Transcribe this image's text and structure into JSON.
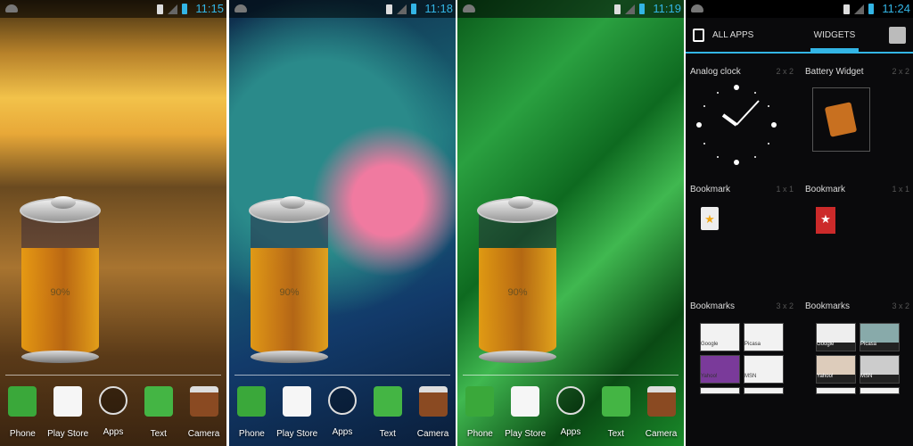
{
  "screens": [
    {
      "time": "11:15",
      "battery_percent": "90%",
      "battery_level": 0.9
    },
    {
      "time": "11:18",
      "battery_percent": "90%",
      "battery_level": 0.9
    },
    {
      "time": "11:19",
      "battery_percent": "90%",
      "battery_level": 0.9
    }
  ],
  "dock": [
    "Phone",
    "Play Store",
    "Apps",
    "Text",
    "Camera"
  ],
  "drawer": {
    "time": "11:24",
    "tab_all_apps": "ALL APPS",
    "tab_widgets": "WIDGETS",
    "widgets": [
      {
        "name": "Analog clock",
        "size": "2 x 2"
      },
      {
        "name": "Battery Widget",
        "size": "2 x 2"
      },
      {
        "name": "Bookmark",
        "size": "1 x 1"
      },
      {
        "name": "Bookmark",
        "size": "1 x 1"
      },
      {
        "name": "Bookmarks",
        "size": "3 x 2"
      },
      {
        "name": "Bookmarks",
        "size": "3 x 2"
      }
    ],
    "bookmark_thumbs": [
      "Google",
      "Picasa",
      "Yahoo!",
      "MSN"
    ]
  },
  "colors": {
    "accent": "#33b5e5",
    "battery_fill": "#e08c14"
  }
}
